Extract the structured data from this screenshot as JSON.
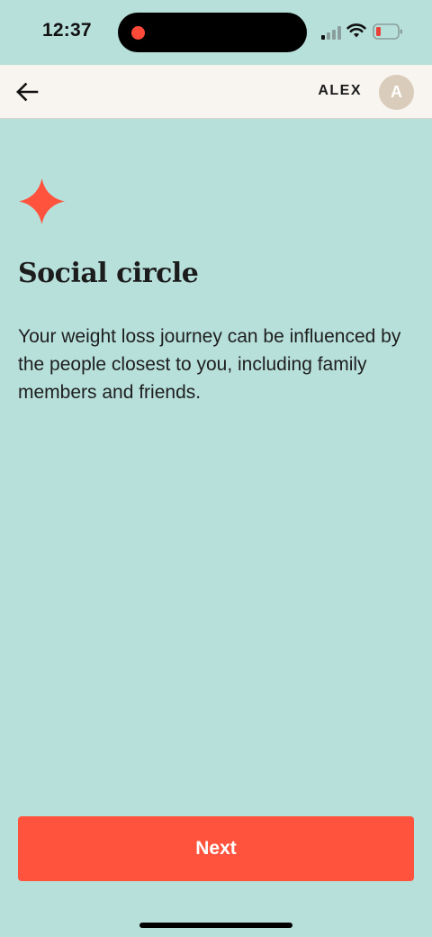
{
  "status_bar": {
    "time": "12:37",
    "battery_color": "#e8413a"
  },
  "header": {
    "back_icon": "arrow-left-icon",
    "user_name": "ALEX",
    "avatar_initial": "A",
    "avatar_color": "#d9ccba"
  },
  "content": {
    "icon": "sparkle-icon",
    "icon_color": "#ff533d",
    "title": "Social circle",
    "description": "Your weight loss journey can be influenced by the people closest to you, including family members and friends."
  },
  "footer": {
    "next_label": "Next",
    "button_color": "#ff533d"
  },
  "theme": {
    "background": "#b7e0db",
    "header_background": "#f8f4ef"
  }
}
